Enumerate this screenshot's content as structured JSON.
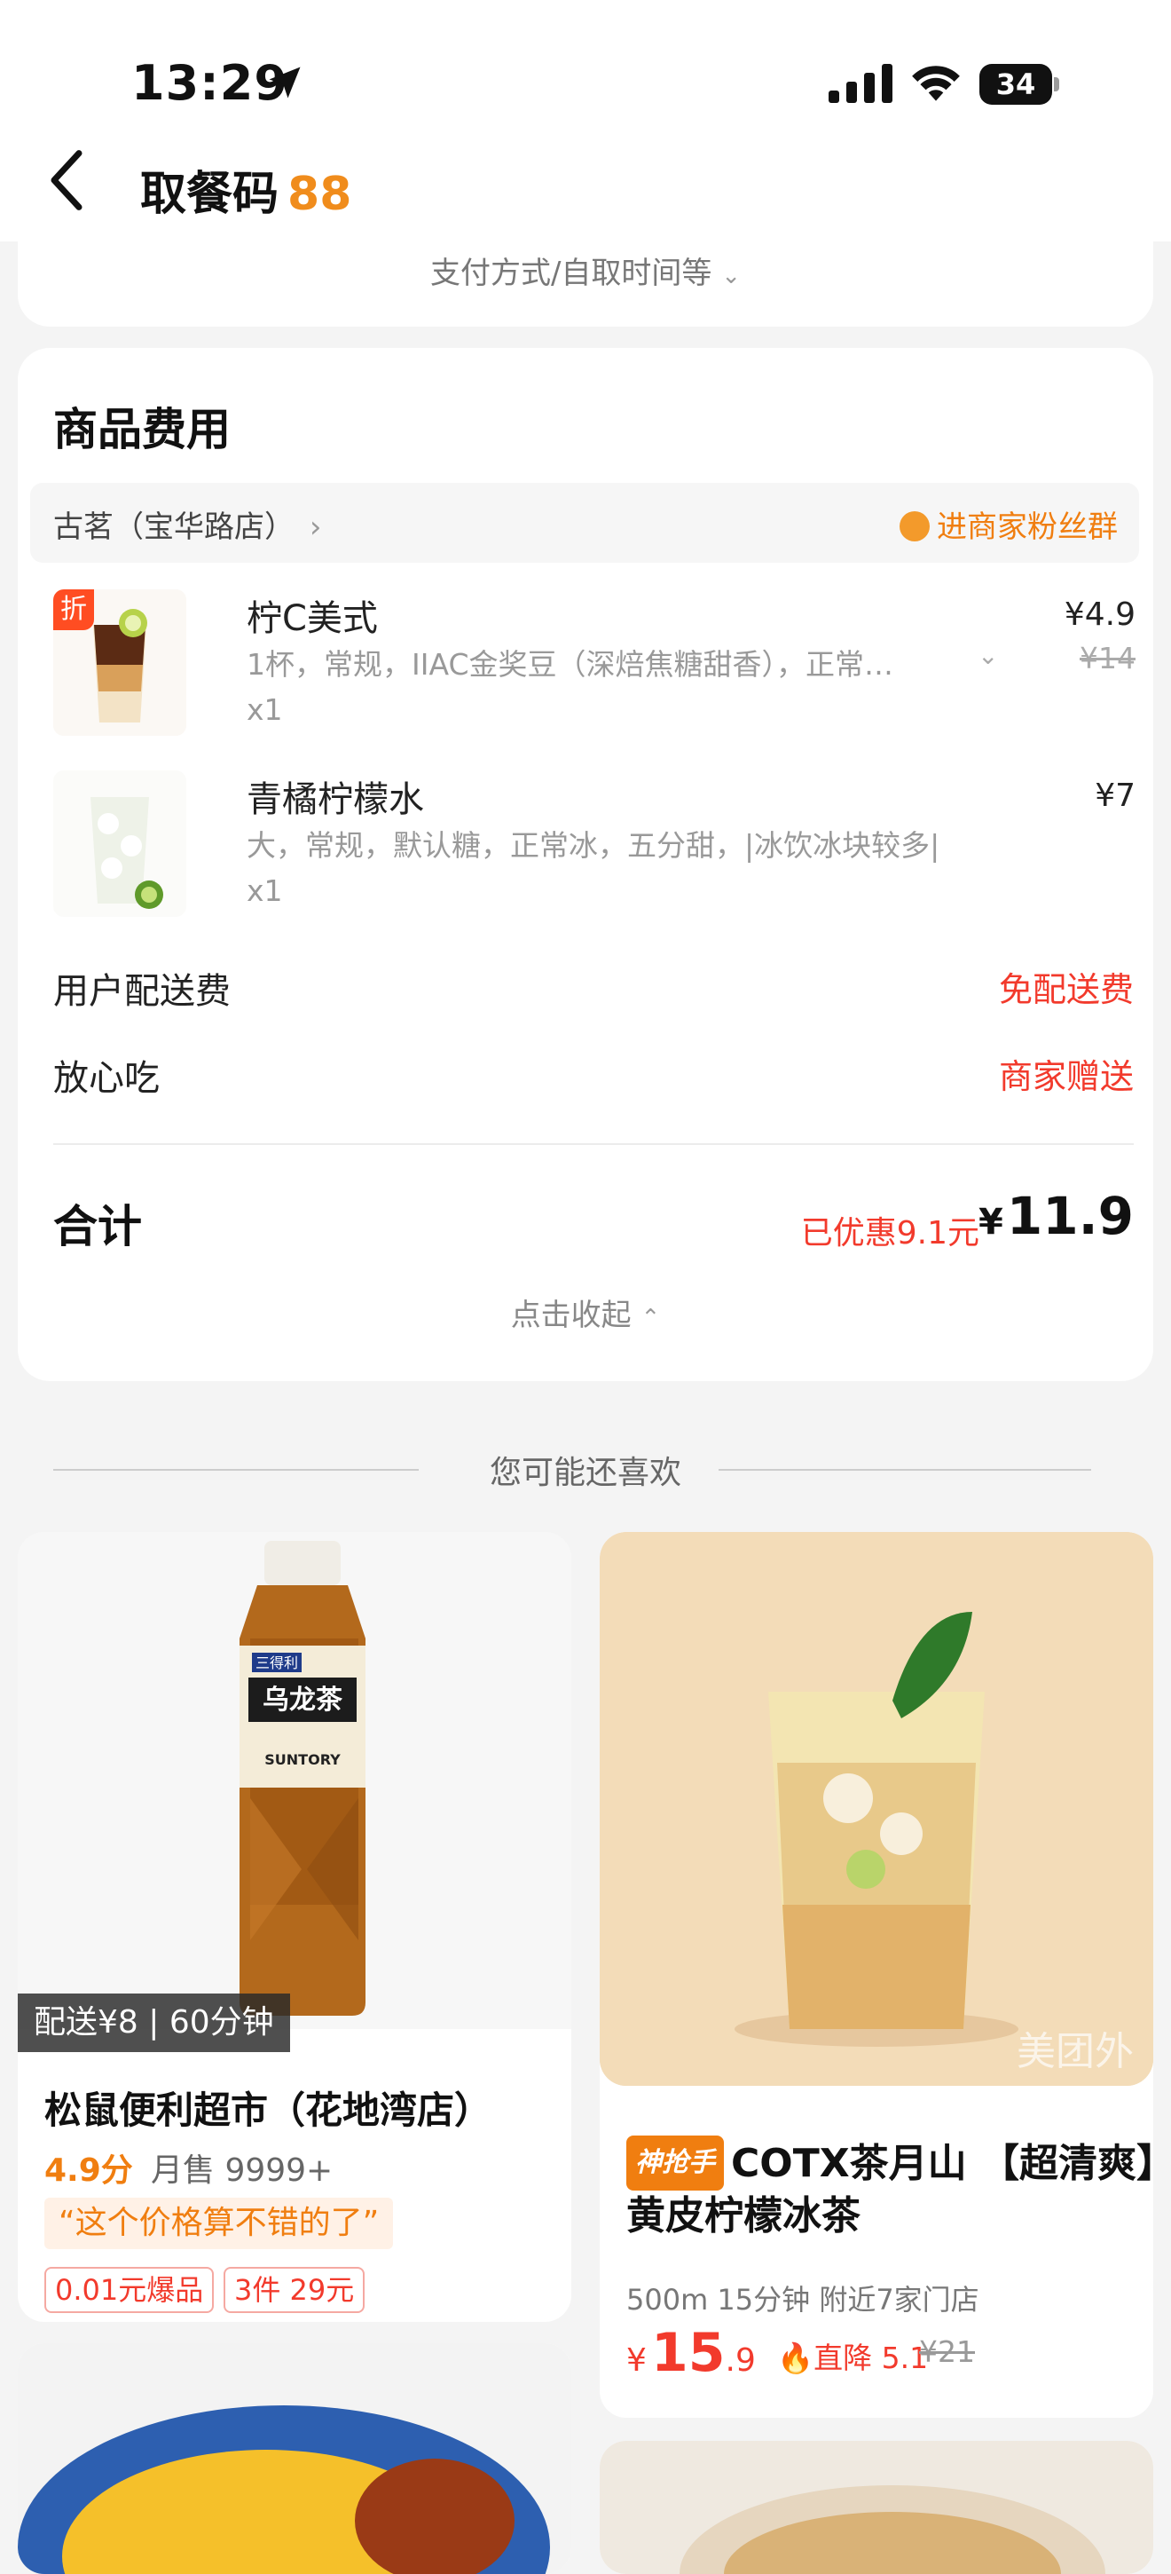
{
  "status_bar": {
    "time": "13:29",
    "battery": "34"
  },
  "header": {
    "title": "取餐码",
    "code": "88"
  },
  "payment_collapsed": {
    "label": "支付方式/自取时间等"
  },
  "order": {
    "section_title": "商品费用",
    "store_name": "古茗（宝华路店）",
    "fans_label": "进商家粉丝群",
    "items": [
      {
        "discount_tag": "折",
        "name": "柠C美式",
        "desc": "1杯，常规，IIAC金奖豆（深焙焦糖甜香），正常…",
        "qty": "x1",
        "price": "¥4.9",
        "original_price": "¥14"
      },
      {
        "name": "青橘柠檬水",
        "desc": "大，常规，默认糖，正常冰，五分甜，|冰饮冰块较多|",
        "qty": "x1",
        "price": "¥7"
      }
    ],
    "fees": [
      {
        "label": "用户配送费",
        "value": "免配送费"
      },
      {
        "label": "放心吃",
        "value": "商家赠送"
      }
    ],
    "total_label": "合计",
    "saved": "已优惠9.1元",
    "total_yen": "¥",
    "total": "11.9",
    "collapse_label": "点击收起"
  },
  "recommend": {
    "title": "您可能还喜欢",
    "cards": [
      {
        "delivery": "配送¥8 | 60分钟",
        "store": "松鼠便利超市（花地湾店）",
        "score": "4.9分",
        "sales": "月售 9999+",
        "quote": "“这个价格算不错的了”",
        "chips": [
          "0.01元爆品",
          "3件 29元"
        ],
        "image_text": [
          "三得利",
          "乌龙茶",
          "SUNTORY"
        ]
      },
      {
        "brand_tag": "神抢手",
        "title": "COTX茶月山 【超清爽】黄皮柠檬冰茶",
        "meta": "500m 15分钟 附近7家门店",
        "price_yen": "¥",
        "price_int": "15",
        "price_dec": ".9",
        "drop": "直降 5.1",
        "old_price": "¥21",
        "watermark": "美团外"
      }
    ]
  },
  "colors": {
    "accent": "#f08c1c",
    "red": "#f23a2c",
    "background": "#f4f4f4"
  }
}
